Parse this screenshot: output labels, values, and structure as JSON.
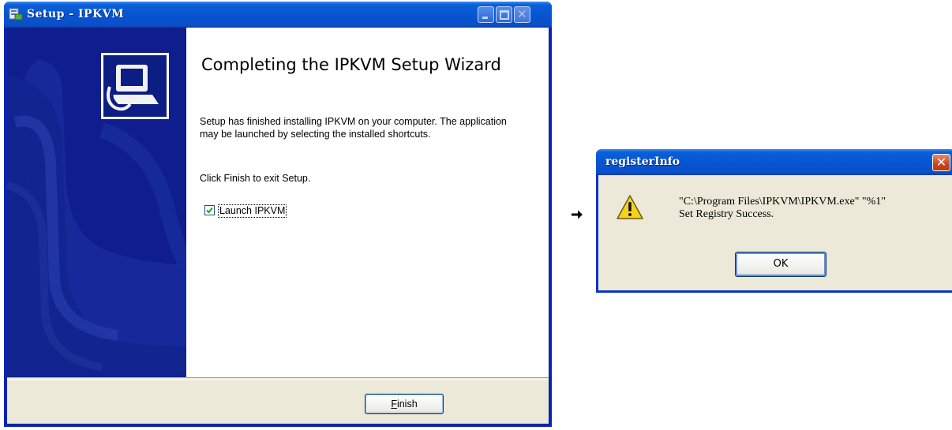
{
  "setup_window": {
    "title": "Setup - IPKVM",
    "heading": "Completing the IPKVM Setup Wizard",
    "description": "Setup has finished installing IPKVM on your computer. The application may be launched by selecting the installed shortcuts.",
    "exit_instruction": "Click Finish to exit Setup.",
    "launch_checkbox": {
      "label": "Launch IPKVM",
      "checked": true
    },
    "finish_button": {
      "mnemonic": "F",
      "rest": "inish"
    },
    "icons": {
      "app": "setup-icon",
      "banner": "computer-install-icon"
    }
  },
  "arrow": "➔",
  "register_dialog": {
    "title": "registerInfo",
    "close": "✕",
    "message_line1": "\"C:\\Program Files\\IPKVM\\IPKVM.exe\" \"%1\"",
    "message_line2": "Set Registry Success.",
    "ok_label": "OK",
    "icon": "warning-icon"
  },
  "colors": {
    "titlebar": "#0754d0",
    "wizard_side_panel": "#0f1e8c",
    "dialog_face": "#ece9d8",
    "close_red": "#c8451e"
  }
}
